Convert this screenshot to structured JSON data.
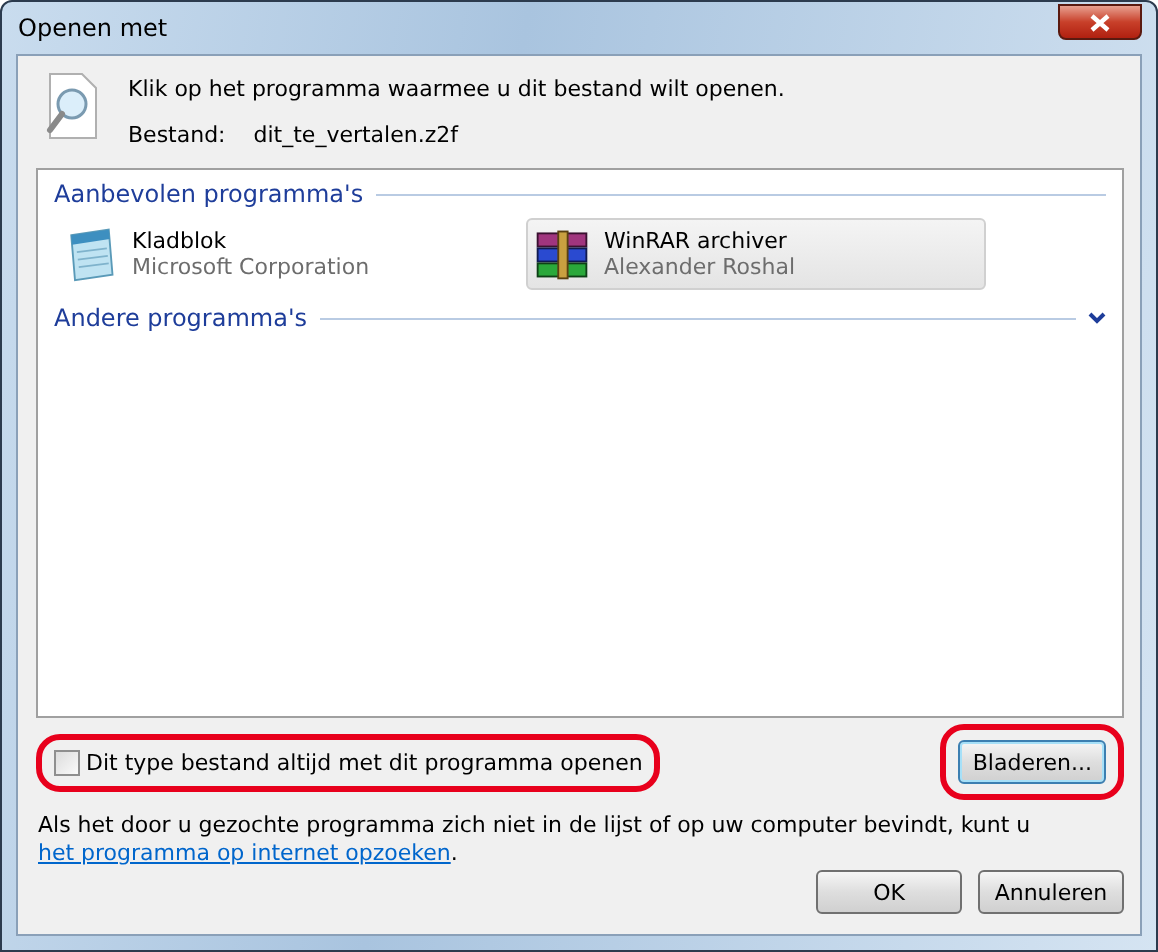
{
  "window": {
    "title": "Openen met"
  },
  "header": {
    "instruction": "Klik op het programma waarmee u dit bestand wilt openen.",
    "file_label": "Bestand:",
    "file_name": "dit_te_vertalen.z2f"
  },
  "groups": [
    {
      "title": "Aanbevolen programma's",
      "programs": [
        {
          "kind": "notepad",
          "name": "Kladblok",
          "publisher": "Microsoft Corporation",
          "selected": false
        },
        {
          "kind": "archiver",
          "name": "WinRAR archiver",
          "publisher": "Alexander Roshal",
          "selected": true
        }
      ]
    },
    {
      "title": "Andere programma's"
    }
  ],
  "always_use": {
    "label": "Dit type bestand altijd met dit programma openen",
    "checked": false,
    "highlighted": true
  },
  "browse_button": {
    "label": "Bladeren...",
    "highlighted": true
  },
  "note": {
    "text": "Als het door u gezochte programma zich niet in de lijst of op uw computer bevindt, kunt u",
    "link": "het programma op internet opzoeken",
    "after": "."
  },
  "buttons": [
    {
      "label": "OK"
    },
    {
      "label": "Annuleren"
    }
  ]
}
